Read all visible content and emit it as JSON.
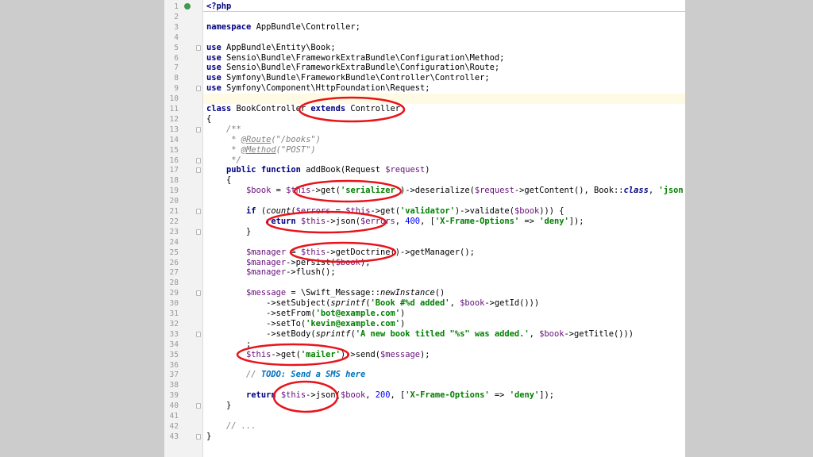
{
  "editor": {
    "language": "php",
    "bookmark_line": 1,
    "highlighted_line": 10,
    "lines": [
      {
        "n": "1",
        "fold": false,
        "tokens": [
          {
            "t": "<?php",
            "c": "kw"
          }
        ]
      },
      {
        "n": "2",
        "fold": false,
        "tokens": []
      },
      {
        "n": "3",
        "fold": false,
        "tokens": [
          {
            "t": "namespace",
            "c": "kw"
          },
          {
            "t": " AppBundle\\Controller;"
          }
        ]
      },
      {
        "n": "4",
        "fold": false,
        "tokens": []
      },
      {
        "n": "5",
        "fold": true,
        "tokens": [
          {
            "t": "use",
            "c": "kw"
          },
          {
            "t": " AppBundle\\Entity\\Book;"
          }
        ]
      },
      {
        "n": "6",
        "fold": false,
        "tokens": [
          {
            "t": "use",
            "c": "kw"
          },
          {
            "t": " Sensio\\Bundle\\FrameworkExtraBundle\\Configuration\\Method;"
          }
        ]
      },
      {
        "n": "7",
        "fold": false,
        "tokens": [
          {
            "t": "use",
            "c": "kw"
          },
          {
            "t": " Sensio\\Bundle\\FrameworkExtraBundle\\Configuration\\Route;"
          }
        ]
      },
      {
        "n": "8",
        "fold": false,
        "tokens": [
          {
            "t": "use",
            "c": "kw"
          },
          {
            "t": " Symfony\\Bundle\\FrameworkBundle\\Controller\\Controller;"
          }
        ]
      },
      {
        "n": "9",
        "fold": true,
        "tokens": [
          {
            "t": "use",
            "c": "kw"
          },
          {
            "t": " Symfony\\Component\\HttpFoundation\\Request;"
          }
        ]
      },
      {
        "n": "10",
        "fold": false,
        "tokens": []
      },
      {
        "n": "11",
        "fold": false,
        "tokens": [
          {
            "t": "class",
            "c": "kw"
          },
          {
            "t": " BookController "
          },
          {
            "t": "extends",
            "c": "kw"
          },
          {
            "t": " Controller"
          }
        ]
      },
      {
        "n": "12",
        "fold": false,
        "tokens": [
          {
            "t": "{"
          }
        ]
      },
      {
        "n": "13",
        "fold": true,
        "tokens": [
          {
            "t": "    "
          },
          {
            "t": "/**",
            "c": "com"
          }
        ]
      },
      {
        "n": "14",
        "fold": false,
        "tokens": [
          {
            "t": "     * ",
            "c": "com"
          },
          {
            "t": "@Route",
            "c": "ann"
          },
          {
            "t": "(\"/books\")",
            "c": "com"
          }
        ]
      },
      {
        "n": "15",
        "fold": false,
        "tokens": [
          {
            "t": "     * ",
            "c": "com"
          },
          {
            "t": "@Method",
            "c": "ann"
          },
          {
            "t": "(\"POST\")",
            "c": "com"
          }
        ]
      },
      {
        "n": "16",
        "fold": true,
        "tokens": [
          {
            "t": "     */",
            "c": "com"
          }
        ]
      },
      {
        "n": "17",
        "fold": true,
        "tokens": [
          {
            "t": "    "
          },
          {
            "t": "public function",
            "c": "kw"
          },
          {
            "t": " addBook(Request "
          },
          {
            "t": "$request",
            "c": "var"
          },
          {
            "t": ")"
          }
        ]
      },
      {
        "n": "18",
        "fold": false,
        "tokens": [
          {
            "t": "    {"
          }
        ]
      },
      {
        "n": "19",
        "fold": false,
        "tokens": [
          {
            "t": "        "
          },
          {
            "t": "$book",
            "c": "var"
          },
          {
            "t": " = "
          },
          {
            "t": "$this",
            "c": "var"
          },
          {
            "t": "->get("
          },
          {
            "t": "'serializer'",
            "c": "str"
          },
          {
            "t": ")->deserialize("
          },
          {
            "t": "$request",
            "c": "var"
          },
          {
            "t": "->getContent(), Book::"
          },
          {
            "t": "class",
            "c": "cls"
          },
          {
            "t": ", "
          },
          {
            "t": "'json'",
            "c": "str"
          },
          {
            "t": ");"
          }
        ]
      },
      {
        "n": "20",
        "fold": false,
        "tokens": []
      },
      {
        "n": "21",
        "fold": true,
        "tokens": [
          {
            "t": "        "
          },
          {
            "t": "if",
            "c": "kw"
          },
          {
            "t": " ("
          },
          {
            "t": "count",
            "c": "fn"
          },
          {
            "t": "("
          },
          {
            "t": "$errors",
            "c": "var"
          },
          {
            "t": " = "
          },
          {
            "t": "$this",
            "c": "var"
          },
          {
            "t": "->get("
          },
          {
            "t": "'validator'",
            "c": "str"
          },
          {
            "t": ")->validate("
          },
          {
            "t": "$book",
            "c": "var"
          },
          {
            "t": "))) {"
          }
        ]
      },
      {
        "n": "22",
        "fold": false,
        "tokens": [
          {
            "t": "            "
          },
          {
            "t": "return",
            "c": "kw"
          },
          {
            "t": " "
          },
          {
            "t": "$this",
            "c": "var"
          },
          {
            "t": "->json("
          },
          {
            "t": "$errors",
            "c": "var"
          },
          {
            "t": ", "
          },
          {
            "t": "400",
            "c": "num"
          },
          {
            "t": ", ["
          },
          {
            "t": "'X-Frame-Options'",
            "c": "str"
          },
          {
            "t": " => "
          },
          {
            "t": "'deny'",
            "c": "str"
          },
          {
            "t": "]);"
          }
        ]
      },
      {
        "n": "23",
        "fold": true,
        "tokens": [
          {
            "t": "        }"
          }
        ]
      },
      {
        "n": "24",
        "fold": false,
        "tokens": []
      },
      {
        "n": "25",
        "fold": false,
        "tokens": [
          {
            "t": "        "
          },
          {
            "t": "$manager",
            "c": "var"
          },
          {
            "t": " = "
          },
          {
            "t": "$this",
            "c": "var"
          },
          {
            "t": "->getDoctrine()->getManager();"
          }
        ]
      },
      {
        "n": "26",
        "fold": false,
        "tokens": [
          {
            "t": "        "
          },
          {
            "t": "$manager",
            "c": "var"
          },
          {
            "t": "->persist("
          },
          {
            "t": "$book",
            "c": "var"
          },
          {
            "t": ");"
          }
        ]
      },
      {
        "n": "27",
        "fold": false,
        "tokens": [
          {
            "t": "        "
          },
          {
            "t": "$manager",
            "c": "var"
          },
          {
            "t": "->flush();"
          }
        ]
      },
      {
        "n": "28",
        "fold": false,
        "tokens": []
      },
      {
        "n": "29",
        "fold": true,
        "tokens": [
          {
            "t": "        "
          },
          {
            "t": "$message",
            "c": "var"
          },
          {
            "t": " = \\Swift_Message::"
          },
          {
            "t": "newInstance",
            "c": "fn"
          },
          {
            "t": "()"
          }
        ]
      },
      {
        "n": "30",
        "fold": false,
        "tokens": [
          {
            "t": "            ->setSubject("
          },
          {
            "t": "sprintf",
            "c": "fn"
          },
          {
            "t": "("
          },
          {
            "t": "'Book #%d added'",
            "c": "str"
          },
          {
            "t": ", "
          },
          {
            "t": "$book",
            "c": "var"
          },
          {
            "t": "->getId()))"
          }
        ]
      },
      {
        "n": "31",
        "fold": false,
        "tokens": [
          {
            "t": "            ->setFrom("
          },
          {
            "t": "'bot@example.com'",
            "c": "str"
          },
          {
            "t": ")"
          }
        ]
      },
      {
        "n": "32",
        "fold": false,
        "tokens": [
          {
            "t": "            ->setTo("
          },
          {
            "t": "'kevin@example.com'",
            "c": "str"
          },
          {
            "t": ")"
          }
        ]
      },
      {
        "n": "33",
        "fold": true,
        "tokens": [
          {
            "t": "            ->setBody("
          },
          {
            "t": "sprintf",
            "c": "fn"
          },
          {
            "t": "("
          },
          {
            "t": "'A new book titled \"%s\" was added.'",
            "c": "str"
          },
          {
            "t": ", "
          },
          {
            "t": "$book",
            "c": "var"
          },
          {
            "t": "->getTitle()))"
          }
        ]
      },
      {
        "n": "34",
        "fold": false,
        "tokens": [
          {
            "t": "        ;"
          }
        ]
      },
      {
        "n": "35",
        "fold": false,
        "tokens": [
          {
            "t": "        "
          },
          {
            "t": "$this",
            "c": "var"
          },
          {
            "t": "->get("
          },
          {
            "t": "'mailer'",
            "c": "str"
          },
          {
            "t": ")->send("
          },
          {
            "t": "$message",
            "c": "var"
          },
          {
            "t": ");"
          }
        ]
      },
      {
        "n": "36",
        "fold": false,
        "tokens": []
      },
      {
        "n": "37",
        "fold": false,
        "tokens": [
          {
            "t": "        "
          },
          {
            "t": "// ",
            "c": "com"
          },
          {
            "t": "TODO: Send a SMS here",
            "c": "todo"
          }
        ]
      },
      {
        "n": "38",
        "fold": false,
        "tokens": []
      },
      {
        "n": "39",
        "fold": false,
        "tokens": [
          {
            "t": "        "
          },
          {
            "t": "return",
            "c": "kw"
          },
          {
            "t": " "
          },
          {
            "t": "$this",
            "c": "var"
          },
          {
            "t": "->json("
          },
          {
            "t": "$book",
            "c": "var"
          },
          {
            "t": ", "
          },
          {
            "t": "200",
            "c": "num"
          },
          {
            "t": ", ["
          },
          {
            "t": "'X-Frame-Options'",
            "c": "str"
          },
          {
            "t": " => "
          },
          {
            "t": "'deny'",
            "c": "str"
          },
          {
            "t": "]);"
          }
        ]
      },
      {
        "n": "40",
        "fold": true,
        "tokens": [
          {
            "t": "    }"
          }
        ]
      },
      {
        "n": "41",
        "fold": false,
        "tokens": []
      },
      {
        "n": "42",
        "fold": false,
        "tokens": [
          {
            "t": "    "
          },
          {
            "t": "// ...",
            "c": "com"
          }
        ]
      },
      {
        "n": "43",
        "fold": true,
        "tokens": [
          {
            "t": "}"
          }
        ]
      }
    ]
  },
  "colors": {
    "annotation_ellipse": "#e8141b",
    "keyword": "#000080",
    "string": "#008000",
    "variable": "#660e7a",
    "comment": "#808080",
    "todo": "#0073bf",
    "number": "#0000ff",
    "current_line": "#fffae3"
  }
}
